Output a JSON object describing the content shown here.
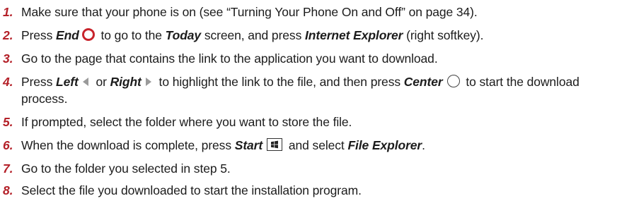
{
  "steps": [
    {
      "num": "1.",
      "t1": "Make sure that your phone is on (see “Turning Your Phone On and Off” on page 34)."
    },
    {
      "num": "2.",
      "t1": "Press ",
      "kw1": "End",
      "t2": " to go to the ",
      "kw2": "Today",
      "t3": " screen, and press ",
      "kw3": "Internet Explorer",
      "t4": " (right softkey)."
    },
    {
      "num": "3.",
      "t1": "Go to the page that contains the link to the application you want to download."
    },
    {
      "num": "4.",
      "t1": "Press ",
      "kw1": "Left",
      "t2": " or ",
      "kw2": "Right",
      "t3": " to highlight the link to the file, and then press ",
      "kw3": "Center",
      "t4": " to start the download process."
    },
    {
      "num": "5.",
      "t1": "If prompted, select the folder where you want to store the file."
    },
    {
      "num": "6.",
      "t1": "When the download is complete, press ",
      "kw1": "Start",
      "t2": " and select ",
      "kw2": "File Explorer",
      "t3": "."
    },
    {
      "num": "7.",
      "t1": "Go to the folder you selected in step 5."
    },
    {
      "num": "8.",
      "t1": "Select the file you downloaded to start the installation program."
    }
  ],
  "icons": {
    "end_key": "end-key-icon",
    "left_key": "left-arrow-key-icon",
    "right_key": "right-arrow-key-icon",
    "center_key": "center-key-icon",
    "start_key": "windows-start-key-icon"
  },
  "colors": {
    "step_number": "#b42129",
    "end_key": "#c8242c",
    "body_text": "#1c1c1c"
  }
}
